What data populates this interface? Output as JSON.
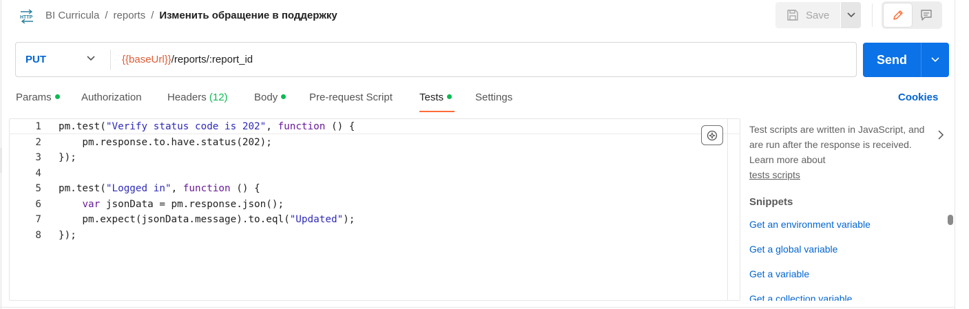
{
  "breadcrumb": {
    "items": [
      "BI Curricula",
      "reports"
    ],
    "separator": "/",
    "current": "Изменить обращение в поддержку"
  },
  "header": {
    "request_type_icon": "http-icon",
    "save_label": "Save"
  },
  "request": {
    "method": "PUT",
    "url_variable": "{{baseUrl}}",
    "url_path": "/reports/:report_id",
    "send_label": "Send"
  },
  "tabs": [
    {
      "label": "Params",
      "dot": true
    },
    {
      "label": "Authorization"
    },
    {
      "label": "Headers",
      "count": "(12)"
    },
    {
      "label": "Body",
      "dot": true
    },
    {
      "label": "Pre-request Script"
    },
    {
      "label": "Tests",
      "dot": true,
      "active": true
    },
    {
      "label": "Settings"
    }
  ],
  "cookies_label": "Cookies",
  "editor": {
    "line_numbers": [
      "1",
      "2",
      "3",
      "4",
      "5",
      "6",
      "7",
      "8"
    ],
    "lines": [
      [
        {
          "t": "pm.test("
        },
        {
          "t": "\"Verify status code is 202\"",
          "c": "str"
        },
        {
          "t": ", "
        },
        {
          "t": "function",
          "c": "kw"
        },
        {
          "t": " () {"
        }
      ],
      [
        {
          "t": "    pm.response.to.have.status(202);"
        }
      ],
      [
        {
          "t": "});"
        }
      ],
      [
        {
          "t": ""
        }
      ],
      [
        {
          "t": "pm.test("
        },
        {
          "t": "\"Logged in\"",
          "c": "str"
        },
        {
          "t": ", "
        },
        {
          "t": "function",
          "c": "kw"
        },
        {
          "t": " () {"
        }
      ],
      [
        {
          "t": "    "
        },
        {
          "t": "var",
          "c": "kw"
        },
        {
          "t": " jsonData = pm.response.json();"
        }
      ],
      [
        {
          "t": "    pm.expect(jsonData.message).to.eql("
        },
        {
          "t": "\"Updated\"",
          "c": "str"
        },
        {
          "t": ");"
        }
      ],
      [
        {
          "t": "});"
        }
      ]
    ]
  },
  "help": {
    "description": "Test scripts are written in JavaScript, and are run after the response is received. Learn more about",
    "link_label": "tests scripts",
    "snippets_title": "Snippets",
    "snippets": [
      "Get an environment variable",
      "Get a global variable",
      "Get a variable",
      "Get a collection variable"
    ]
  },
  "colors": {
    "accent_orange": "#ff6c37",
    "send_blue": "#0b72e7",
    "link_blue": "#0265d2",
    "status_green": "#0cbb52",
    "url_variable": "#e05b34"
  }
}
